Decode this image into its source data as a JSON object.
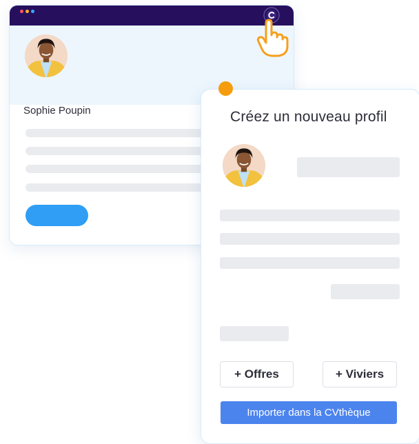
{
  "back_card": {
    "profile_name": "Sophie Poupin"
  },
  "front_card": {
    "title": "Créez un nouveau profil",
    "buttons": {
      "offers_label": "+ Offres",
      "pools_label": "+ Viviers",
      "import_label": "Importer dans la CVthèque"
    }
  },
  "icons": {
    "window_dots": [
      "window-dot-red-icon",
      "window-dot-orange-icon",
      "window-dot-blue-icon"
    ],
    "extension": "target-icon",
    "cursor": "pointing-hand-icon",
    "status": "orange-dot-icon"
  },
  "colors": {
    "titlebar": "#26105e",
    "accent_blue": "#2f9ef4",
    "import_button": "#4c84ee",
    "orange": "#f59d0e",
    "placeholder_bar": "#e9ebef"
  }
}
